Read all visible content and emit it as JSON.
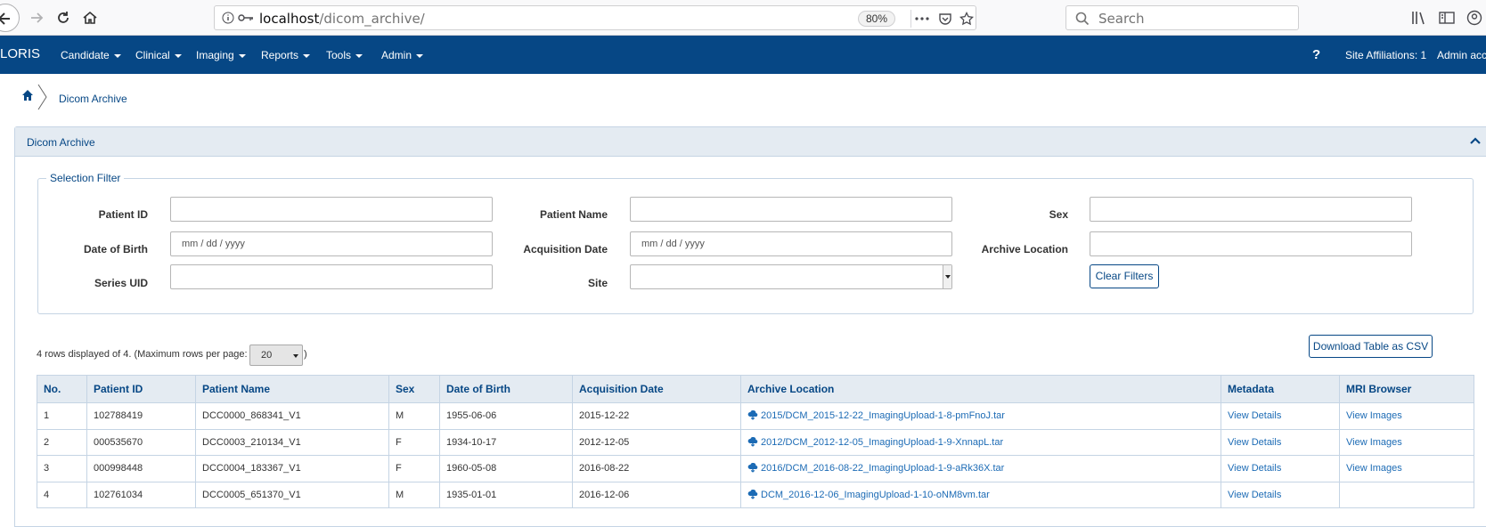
{
  "browser": {
    "url_host": "localhost",
    "url_path": "/dicom_archive/",
    "zoom": "80%",
    "search_placeholder": "Search"
  },
  "navbar": {
    "brand": "LORIS",
    "menus": [
      "Candidate",
      "Clinical",
      "Imaging",
      "Reports",
      "Tools",
      "Admin"
    ],
    "help": "?",
    "site_affiliations": "Site Affiliations: 1",
    "user": "Admin acco"
  },
  "breadcrumb": {
    "label": "Dicom Archive"
  },
  "panel": {
    "title": "Dicom Archive"
  },
  "filter": {
    "legend": "Selection Filter",
    "labels": {
      "patient_id": "Patient ID",
      "patient_name": "Patient Name",
      "sex": "Sex",
      "dob": "Date of Birth",
      "acq_date": "Acquisition Date",
      "archive_location": "Archive Location",
      "series_uid": "Series UID",
      "site": "Site"
    },
    "date_placeholder": "mm / dd / yyyy",
    "clear_label": "Clear Filters"
  },
  "table_info": {
    "rows_text": "4 rows displayed of 4. (Maximum rows per page:",
    "max_rows": "20",
    "close_paren": ")",
    "download_label": "Download Table as CSV"
  },
  "table": {
    "headers": [
      "No.",
      "Patient ID",
      "Patient Name",
      "Sex",
      "Date of Birth",
      "Acquisition Date",
      "Archive Location",
      "Metadata",
      "MRI Browser"
    ],
    "rows": [
      {
        "no": "1",
        "patient_id": "102788419",
        "patient_name": "DCC0000_868341_V1",
        "sex": "M",
        "dob": "1955-06-06",
        "acq_date": "2015-12-22",
        "archive": "2015/DCM_2015-12-22_ImagingUpload-1-8-pmFnoJ.tar",
        "metadata": "View Details",
        "mri": "View Images"
      },
      {
        "no": "2",
        "patient_id": "000535670",
        "patient_name": "DCC0003_210134_V1",
        "sex": "F",
        "dob": "1934-10-17",
        "acq_date": "2012-12-05",
        "archive": "2012/DCM_2012-12-05_ImagingUpload-1-9-XnnapL.tar",
        "metadata": "View Details",
        "mri": "View Images"
      },
      {
        "no": "3",
        "patient_id": "000998448",
        "patient_name": "DCC0004_183367_V1",
        "sex": "F",
        "dob": "1960-05-08",
        "acq_date": "2016-08-22",
        "archive": "2016/DCM_2016-08-22_ImagingUpload-1-9-aRk36X.tar",
        "metadata": "View Details",
        "mri": "View Images"
      },
      {
        "no": "4",
        "patient_id": "102761034",
        "patient_name": "DCC0005_651370_V1",
        "sex": "M",
        "dob": "1935-01-01",
        "acq_date": "2016-12-06",
        "archive": "DCM_2016-12-06_ImagingUpload-1-10-oNM8vm.tar",
        "metadata": "View Details",
        "mri": ""
      }
    ]
  },
  "colors": {
    "navbar": "#064785",
    "link": "#1c6bb5",
    "panel_head": "#e4ebf2",
    "border": "#c5d4e4"
  }
}
